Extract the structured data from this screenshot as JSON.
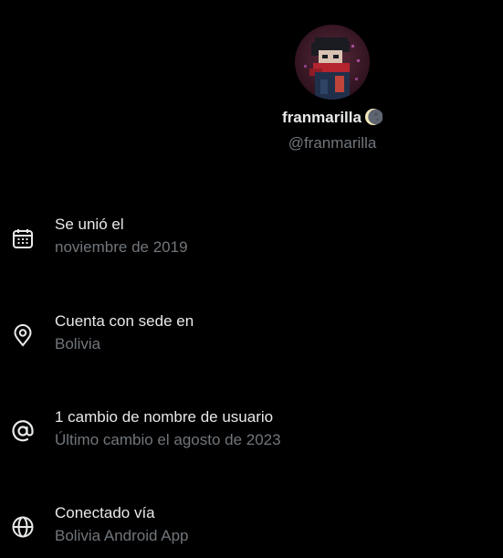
{
  "profile": {
    "display_name": "franmarilla",
    "handle": "@franmarilla",
    "name_emoji_icon": "waning-moon-icon"
  },
  "info": [
    {
      "icon": "calendar-icon",
      "label": "Se unió el",
      "value": "noviembre de 2019"
    },
    {
      "icon": "location-pin-icon",
      "label": "Cuenta con sede en",
      "value": "Bolivia"
    },
    {
      "icon": "at-sign-icon",
      "label": "1 cambio de nombre de usuario",
      "value": "Último cambio el agosto de 2023"
    },
    {
      "icon": "globe-icon",
      "label": "Conectado vía",
      "value": "Bolivia Android App"
    }
  ],
  "colors": {
    "background": "#000000",
    "primary_text": "#e7e9ea",
    "secondary_text": "#71767b"
  }
}
